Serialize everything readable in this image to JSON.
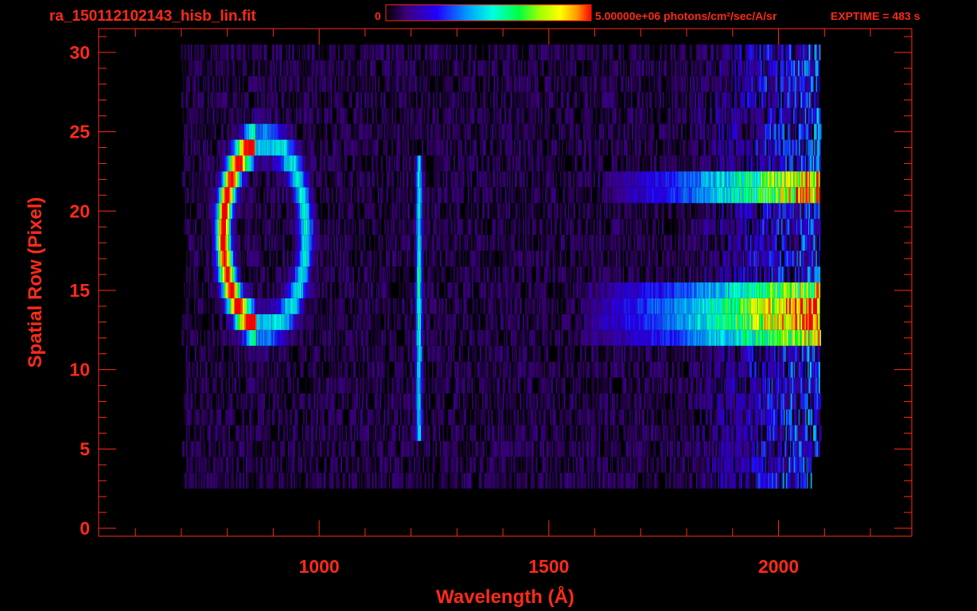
{
  "chart_data": {
    "type": "heatmap",
    "title": "ra_150112102143_hisb_lin.fit",
    "xlabel": "Wavelength (Å)",
    "ylabel": "Spatial Row (Pixel)",
    "xlim": [
      520,
      2290
    ],
    "ylim": [
      -0.5,
      31.5
    ],
    "xticks": [
      1000,
      1500,
      2000
    ],
    "yticks": [
      0,
      5,
      10,
      15,
      20,
      25,
      30
    ],
    "colorbar": {
      "min_label": "0",
      "max_label": "5.00000e+06 photons/cm²/sec/A/sr",
      "exptime_label": "EXPTIME = 483 s",
      "colormap": [
        "#000000",
        "#3b007a",
        "#2200ff",
        "#00a0ff",
        "#00ffe0",
        "#00ff40",
        "#a0ff00",
        "#ffff00",
        "#ff9a00",
        "#ff0000"
      ]
    },
    "data_extent": {
      "x": [
        700,
        2090
      ],
      "rows": [
        3,
        30
      ]
    },
    "features": [
      {
        "name": "arc",
        "x_center": 870,
        "row_center": 18,
        "intensity_peak": 0.95
      },
      {
        "name": "line",
        "x": 1216,
        "rows": [
          6,
          23
        ],
        "intensity_peak": 0.55
      },
      {
        "name": "band-upper",
        "rows": [
          21,
          22
        ],
        "x_range": [
          1700,
          2070
        ],
        "intensity_peak": 0.6
      },
      {
        "name": "band-lower",
        "rows": [
          12,
          15
        ],
        "x_range": [
          1650,
          2070
        ],
        "intensity_peak": 0.7
      }
    ],
    "colors": {
      "axis": "#ff2a1a",
      "background": "#000000"
    }
  }
}
